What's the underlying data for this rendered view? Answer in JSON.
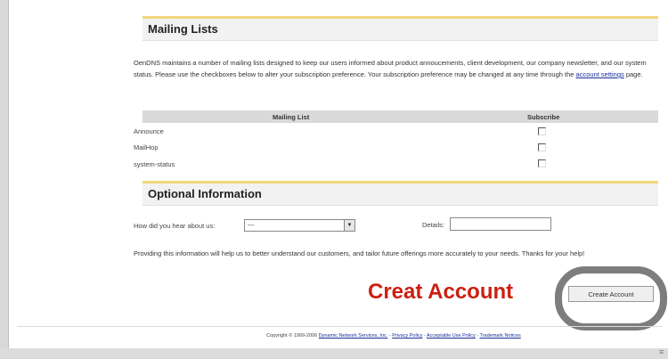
{
  "mailing_lists": {
    "title": "Mailing Lists",
    "intro_before": "OenDNS maintains a number of mailing lists designed to keep our users informed about product annoucements, client development, our company newsletter, and our system status. Please use the checkboxes below to alter your subscription preference. Your subscription preference may be changed at any time through the ",
    "intro_link": "account settings",
    "intro_after": " page.",
    "col_list": "Mailing List",
    "col_subscribe": "Subscribe",
    "rows": [
      {
        "label": "Announce"
      },
      {
        "label": "MailHop"
      },
      {
        "label": "system-status"
      }
    ]
  },
  "optional": {
    "title": "Optional Information",
    "hear_label": "How did you hear about us:",
    "hear_value": "---",
    "details_label": "Details:",
    "details_value": "",
    "help": "Providing this information will help us to better understand our customers, and tailor future offerings more accurately to your needs. Thanks for your help!"
  },
  "annotation": "Creat Account",
  "button": {
    "label": "Create Account"
  },
  "footer": {
    "copyright": "Copyright © 1999-2006",
    "company": "Dynamic Network Services, Inc.",
    "sep": " - ",
    "privacy": "Privacy Policy",
    "aup": "Acceptable Use Policy",
    "trademark": "Trademark Notices"
  }
}
